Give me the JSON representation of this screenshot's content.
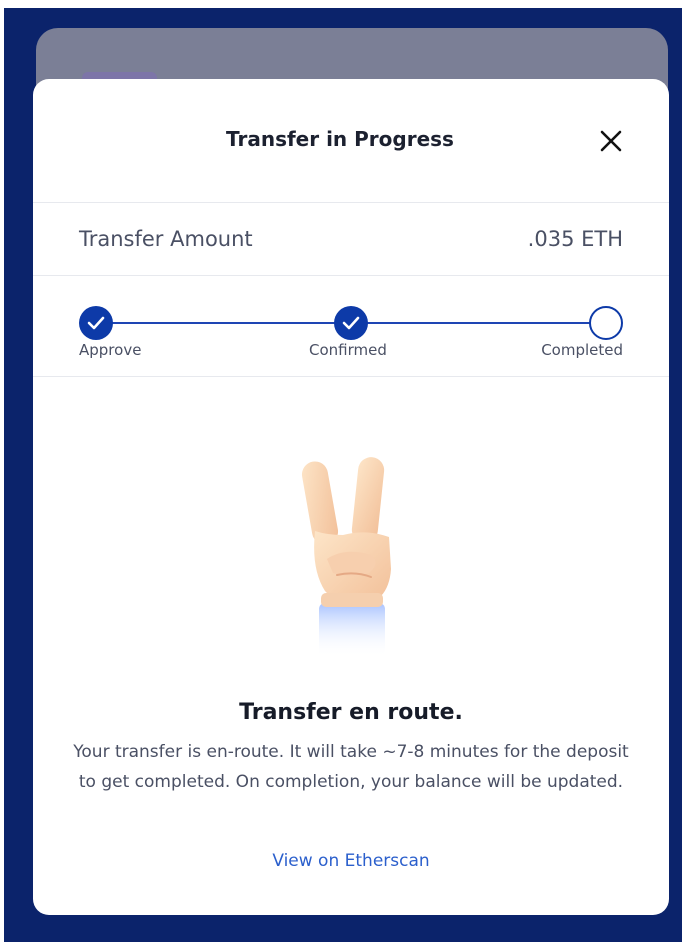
{
  "modal": {
    "title": "Transfer in Progress",
    "close_icon": "close-icon"
  },
  "transfer": {
    "amount_label": "Transfer Amount",
    "amount_value": ".035 ETH"
  },
  "stepper": {
    "steps": [
      {
        "label": "Approve",
        "state": "done"
      },
      {
        "label": "Confirmed",
        "state": "done"
      },
      {
        "label": "Completed",
        "state": "pending"
      }
    ]
  },
  "illustration": {
    "icon": "victory-hand-icon"
  },
  "status": {
    "title": "Transfer en route.",
    "body": "Your transfer is en-route. It will take ~7-8 minutes for the deposit to get completed. On completion, your balance will be updated.",
    "link_label": "View on Etherscan"
  },
  "colors": {
    "background": "#0b236b",
    "accent": "#0d3aa8",
    "link": "#2b5fcc",
    "backdrop_card": "#7b7f96"
  }
}
